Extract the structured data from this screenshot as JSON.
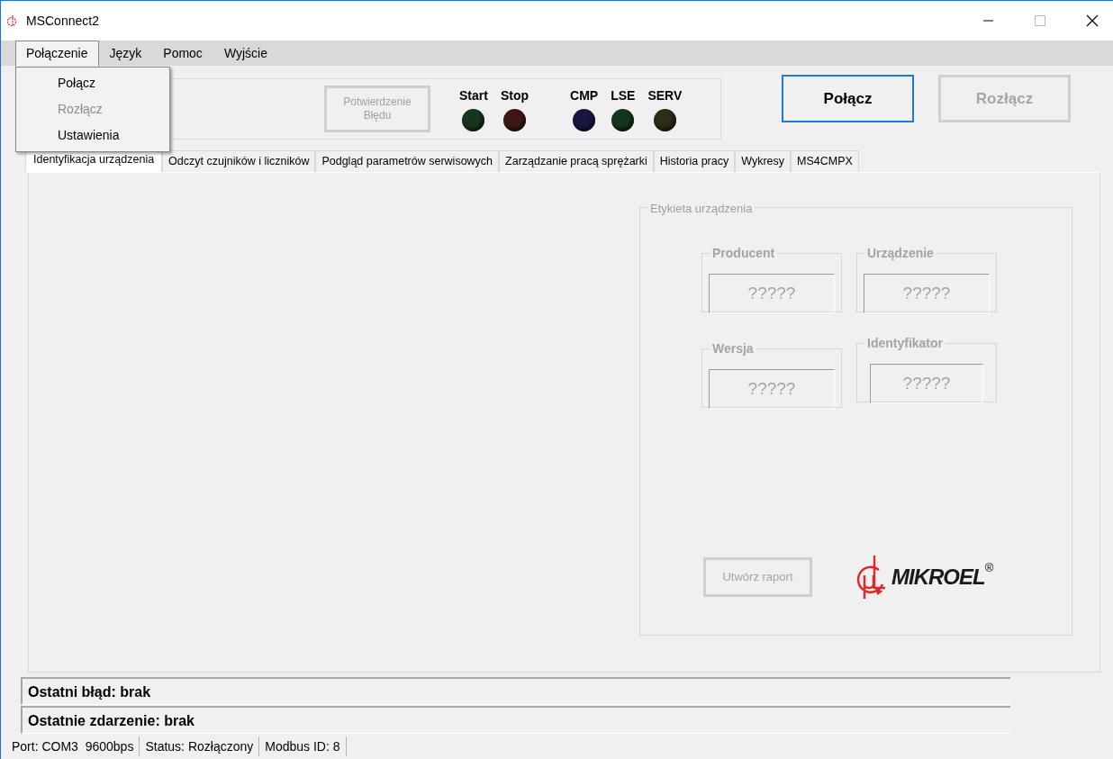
{
  "window": {
    "title": "MSConnect2"
  },
  "menu": [
    {
      "label": "Połączenie",
      "selected": true
    },
    {
      "label": "Język",
      "selected": false
    },
    {
      "label": "Pomoc",
      "selected": false
    },
    {
      "label": "Wyjście",
      "selected": false
    }
  ],
  "dropdown": [
    {
      "label": "Połącz",
      "disabled": false
    },
    {
      "label": "Rozłącz",
      "disabled": true
    },
    {
      "label": "Ustawienia",
      "disabled": false
    }
  ],
  "toolbar": {
    "ack_button": {
      "label": "Potwierdzenie Błędu",
      "disabled": true
    },
    "indicators": [
      {
        "label": "Start",
        "color": "#17351c"
      },
      {
        "label": "Stop",
        "color": "#3f1712"
      },
      {
        "label": "CMP",
        "color": "#17173f"
      },
      {
        "label": "LSE",
        "color": "#16351d"
      },
      {
        "label": "SERV",
        "color": "#2c2c17"
      }
    ],
    "connect_button": {
      "label": "Połącz",
      "disabled": false,
      "focused": true
    },
    "disconnect_button": {
      "label": "Rozłącz",
      "disabled": true,
      "focused": false
    }
  },
  "tabs": [
    {
      "label": "Identyfikacja urządzenia",
      "selected": true
    },
    {
      "label": "Odczyt czujników i liczników",
      "selected": false
    },
    {
      "label": "Podgląd parametrów serwisowych",
      "selected": false
    },
    {
      "label": "Zarządzanie pracą sprężarki",
      "selected": false
    },
    {
      "label": "Historia pracy",
      "selected": false
    },
    {
      "label": "Wykresy",
      "selected": false
    },
    {
      "label": "MS4CMPX",
      "selected": false
    }
  ],
  "device_label": {
    "title": "Etykieta urządzenia",
    "disabled": true,
    "fields": [
      {
        "label": "Producent",
        "value": "?????"
      },
      {
        "label": "Urządzenie",
        "value": "?????"
      },
      {
        "label": "Wersja",
        "value": "?????"
      },
      {
        "label": "Identyfikator",
        "value": "?????"
      }
    ],
    "report_button": {
      "label": "Utwórz raport",
      "disabled": true
    },
    "logo": {
      "text": "MIKROEL",
      "mark": "®"
    }
  },
  "messages": [
    "Ostatni błąd: brak",
    "Ostatnie zdarzenie: brak"
  ],
  "status_bar": [
    "Port: COM3  9600bps",
    "Status: Rozłączony",
    "Modbus ID: 8"
  ]
}
